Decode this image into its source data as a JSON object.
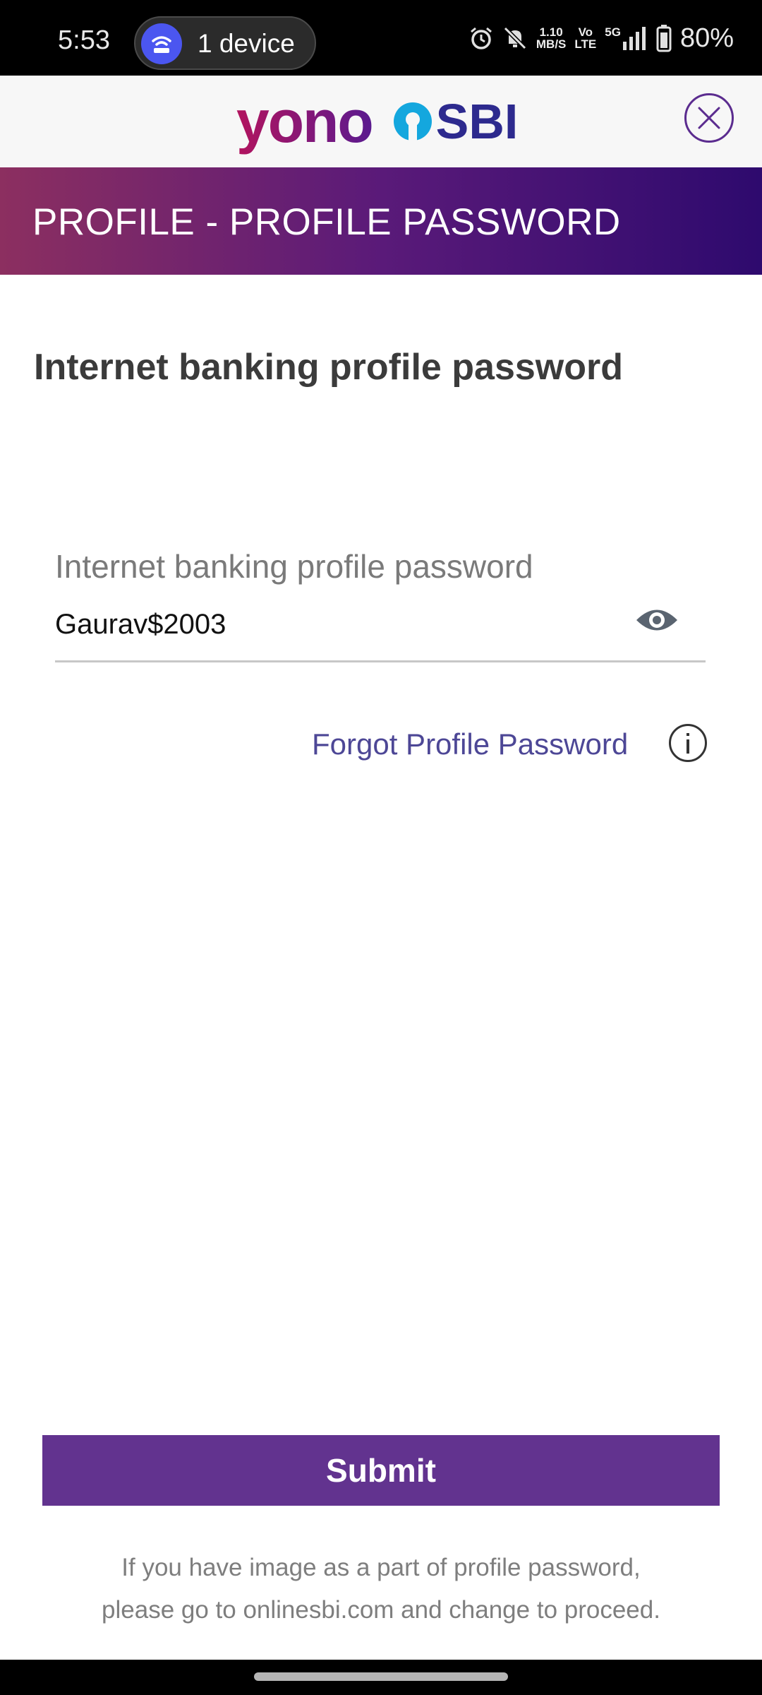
{
  "status_bar": {
    "time": "5:53",
    "hotspot_label": "1 device",
    "speed_value": "1.10",
    "speed_unit": "MB/S",
    "volte_top": "Vo",
    "volte_bottom": "LTE",
    "network": "5G",
    "battery": "80%",
    "icons": [
      "hotspot-icon",
      "alarm-icon",
      "bell-muted-icon",
      "signal-icon",
      "battery-icon"
    ]
  },
  "header": {
    "logo_yono": "yono",
    "logo_sbi": "SBI",
    "close_icon": "close-icon"
  },
  "page_title": "PROFILE - PROFILE PASSWORD",
  "section_heading": "Internet banking profile password",
  "password_field": {
    "label": "Internet banking profile password",
    "value": "Gaurav$2003",
    "toggle_icon": "eye-icon"
  },
  "forgot_link": "Forgot Profile Password",
  "info_icon": "info-icon",
  "submit_label": "Submit",
  "note_line1": "If you have image as a part of profile password,",
  "note_line2": "please go to onlinesbi.com and change to proceed.",
  "colors": {
    "accent": "#62338f",
    "link": "#4d4796",
    "title_gradient_start": "#8c2f60",
    "title_gradient_end": "#2e0a6e"
  }
}
